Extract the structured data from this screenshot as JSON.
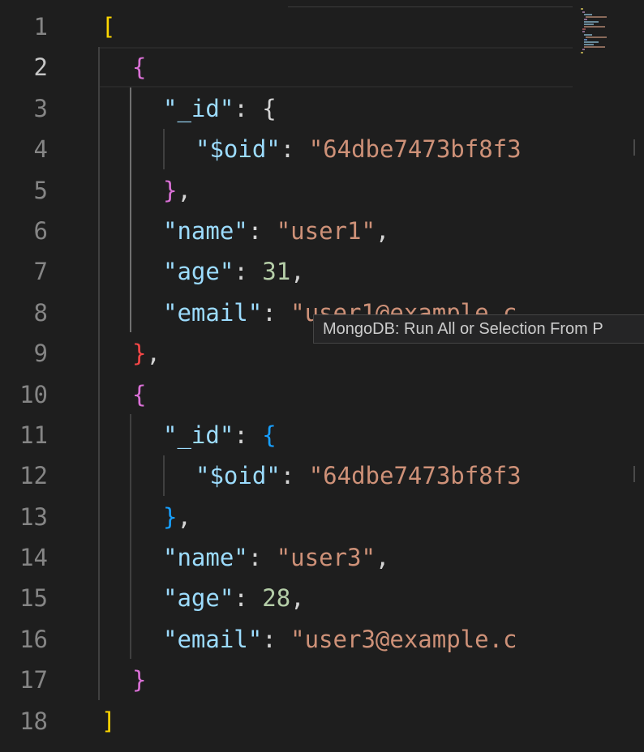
{
  "editor": {
    "active_line": 2,
    "line_numbers": [
      "1",
      "2",
      "3",
      "4",
      "5",
      "6",
      "7",
      "8",
      "9",
      "10",
      "11",
      "12",
      "13",
      "14",
      "15",
      "16",
      "17",
      "18"
    ],
    "lines": {
      "l1": {
        "open": "["
      },
      "l2": {
        "open": "{"
      },
      "l3": {
        "key": "\"_id\"",
        "colon": ": ",
        "open": "{"
      },
      "l4": {
        "key": "\"$oid\"",
        "colon": ": ",
        "value": "\"64dbe7473bf8f3"
      },
      "l5": {
        "close": "}",
        "comma": ","
      },
      "l6": {
        "key": "\"name\"",
        "colon": ": ",
        "value": "\"user1\"",
        "comma": ","
      },
      "l7": {
        "key": "\"age\"",
        "colon": ": ",
        "value": "31",
        "comma": ","
      },
      "l8": {
        "key": "\"email\"",
        "colon": ": ",
        "value": "\"user1@example.c"
      },
      "l9": {
        "close": "}",
        "comma": ","
      },
      "l10": {
        "open": "{"
      },
      "l11": {
        "key": "\"_id\"",
        "colon": ": ",
        "open": "{"
      },
      "l12": {
        "key": "\"$oid\"",
        "colon": ": ",
        "value": "\"64dbe7473bf8f3"
      },
      "l13": {
        "close": "}",
        "comma": ","
      },
      "l14": {
        "key": "\"name\"",
        "colon": ": ",
        "value": "\"user3\"",
        "comma": ","
      },
      "l15": {
        "key": "\"age\"",
        "colon": ": ",
        "value": "28",
        "comma": ","
      },
      "l16": {
        "key": "\"email\"",
        "colon": ": ",
        "value": "\"user3@example.c"
      },
      "l17": {
        "close": "}"
      },
      "l18": {
        "close": "]"
      }
    }
  },
  "tooltip": {
    "text": "MongoDB: Run All or Selection From P"
  },
  "colors": {
    "background": "#1e1e1e",
    "key": "#9cdcfe",
    "string": "#ce9178",
    "number": "#b5cea8",
    "bracket_level1": "#ffd700",
    "bracket_level2": "#da70d6",
    "bracket_level3": "#179fff",
    "bracket_error": "#f44747"
  }
}
